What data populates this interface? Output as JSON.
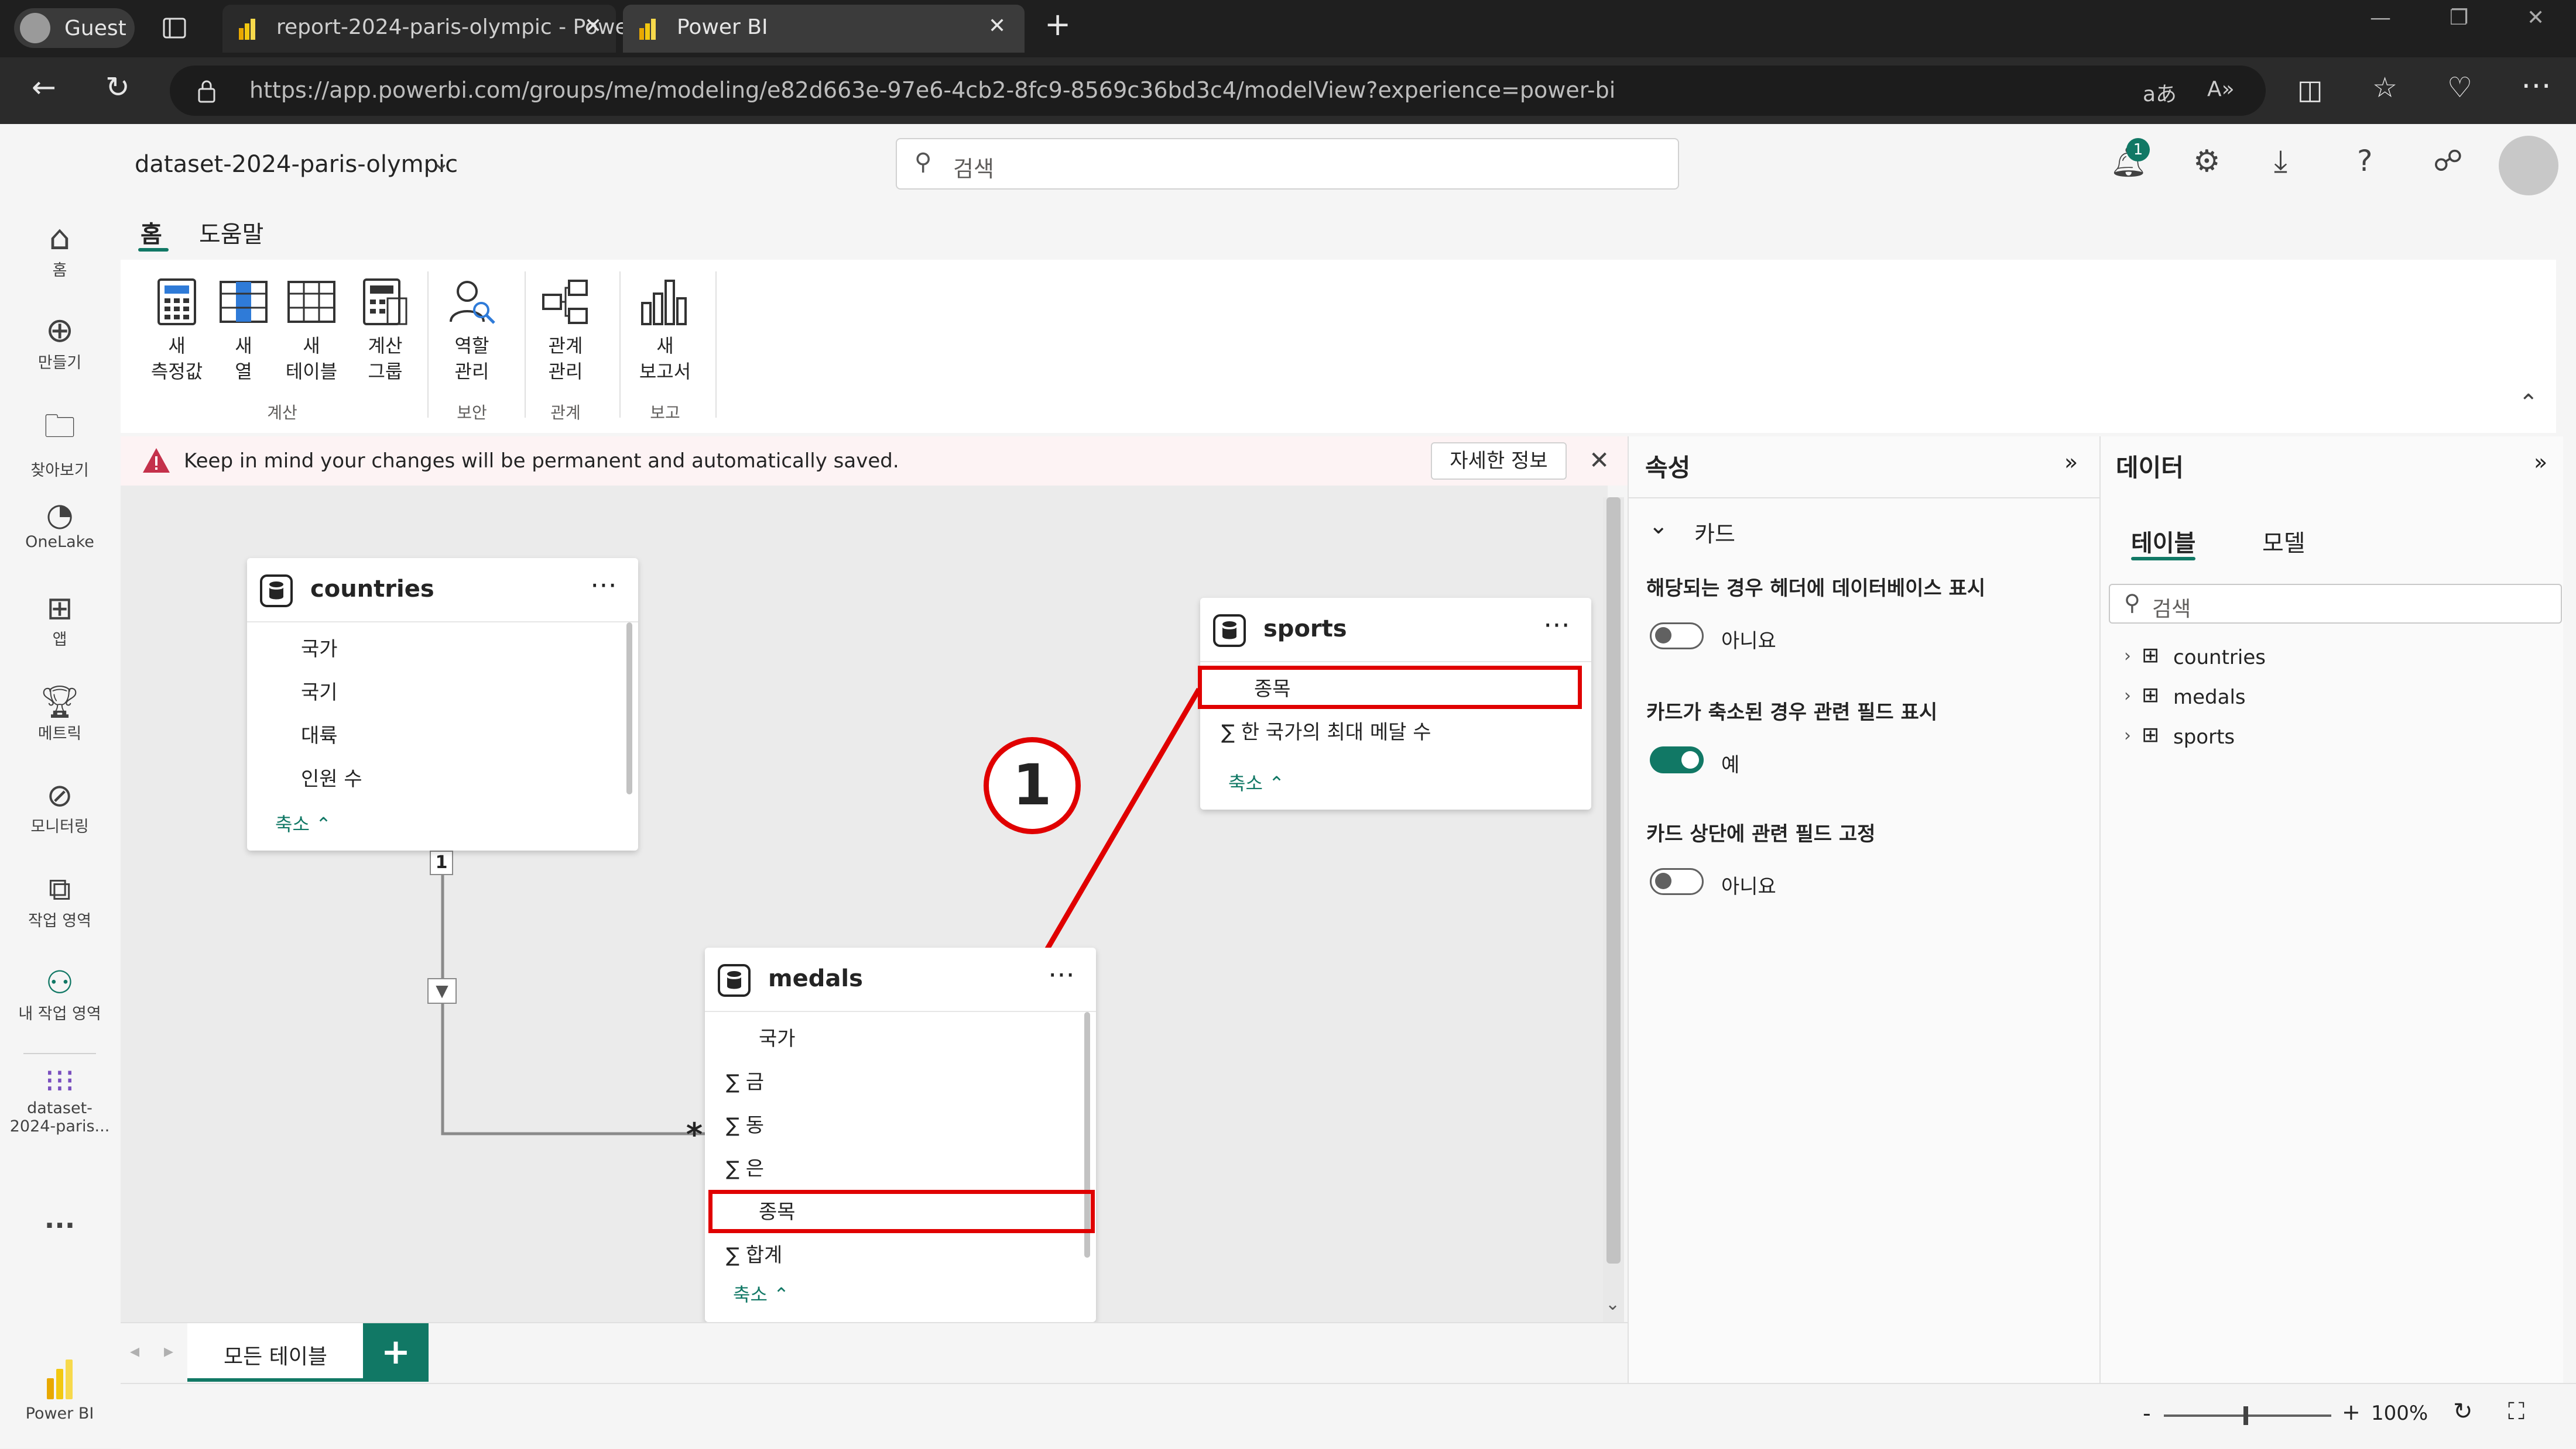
{
  "browser": {
    "profile": "Guest",
    "tabs": [
      {
        "label": "report-2024-paris-olympic - Powe"
      },
      {
        "label": "Power BI"
      }
    ],
    "url": "https://app.powerbi.com/groups/me/modeling/e82d663e-97e6-4cb2-8fc9-8569c36bd3c4/modelView?experience=power-bi",
    "reader_icon_text": "aあ"
  },
  "app": {
    "dataset_name": "dataset-2024-paris-olympic",
    "search_placeholder": "검색",
    "notification_count": "1"
  },
  "rail": {
    "items": [
      {
        "label": "홈"
      },
      {
        "label": "만들기"
      },
      {
        "label": "찾아보기"
      },
      {
        "label": "OneLake"
      },
      {
        "label": "앱"
      },
      {
        "label": "메트릭"
      },
      {
        "label": "모니터링"
      },
      {
        "label": "작업 영역"
      },
      {
        "label": "내 작업 영역"
      },
      {
        "label": "dataset-2024-paris..."
      }
    ],
    "more": "...",
    "product": "Power BI"
  },
  "ribbon": {
    "tabs": [
      {
        "label": "홈"
      },
      {
        "label": "도움말"
      }
    ],
    "buttons": [
      {
        "line1": "새",
        "line2": "측정값"
      },
      {
        "line1": "새",
        "line2": "열"
      },
      {
        "line1": "새",
        "line2": "테이블"
      },
      {
        "line1": "계산",
        "line2": "그룹"
      },
      {
        "line1": "역할",
        "line2": "관리"
      },
      {
        "line1": "관계",
        "line2": "관리"
      },
      {
        "line1": "새",
        "line2": "보고서"
      }
    ],
    "groups": [
      {
        "label": "계산"
      },
      {
        "label": "보안"
      },
      {
        "label": "관계"
      },
      {
        "label": "보고"
      }
    ]
  },
  "banner": {
    "message": "Keep in mind your changes will be permanent and automatically saved.",
    "details_button": "자세한 정보"
  },
  "diagram": {
    "tables": [
      {
        "name": "countries",
        "fields": [
          "국가",
          "국기",
          "대륙",
          "인원 수"
        ],
        "collapse": "축소"
      },
      {
        "name": "sports",
        "fields": [
          "종목",
          "∑ 한 국가의 최대 메달 수"
        ],
        "collapse": "축소"
      },
      {
        "name": "medals",
        "fields": [
          "국가",
          "∑ 금",
          "∑ 동",
          "∑ 은",
          "종목",
          "∑ 합계"
        ],
        "collapse": "축소"
      }
    ],
    "relationship": {
      "one": "1",
      "many": "*"
    },
    "step_marker": "1",
    "tab_label": "모든 테이블",
    "add_tab": "+"
  },
  "properties": {
    "title": "속성",
    "section": "카드",
    "options": [
      {
        "label": "해당되는 경우 헤더에 데이터베이스 표시",
        "value": "아니요",
        "on": false
      },
      {
        "label": "카드가 축소된 경우 관련 필드 표시",
        "value": "예",
        "on": true
      },
      {
        "label": "카드 상단에 관련 필드 고정",
        "value": "아니요",
        "on": false
      }
    ]
  },
  "data_pane": {
    "title": "데이터",
    "tabs": [
      {
        "label": "테이블"
      },
      {
        "label": "모델"
      }
    ],
    "search_placeholder": "검색",
    "tables": [
      {
        "name": "countries"
      },
      {
        "name": "medals"
      },
      {
        "name": "sports"
      }
    ]
  },
  "statusbar": {
    "zoom": "100%"
  },
  "colors": {
    "accent": "#117865",
    "highlight": "#e00000",
    "warning": "#c4314b",
    "powerbi": "#f2c811"
  }
}
